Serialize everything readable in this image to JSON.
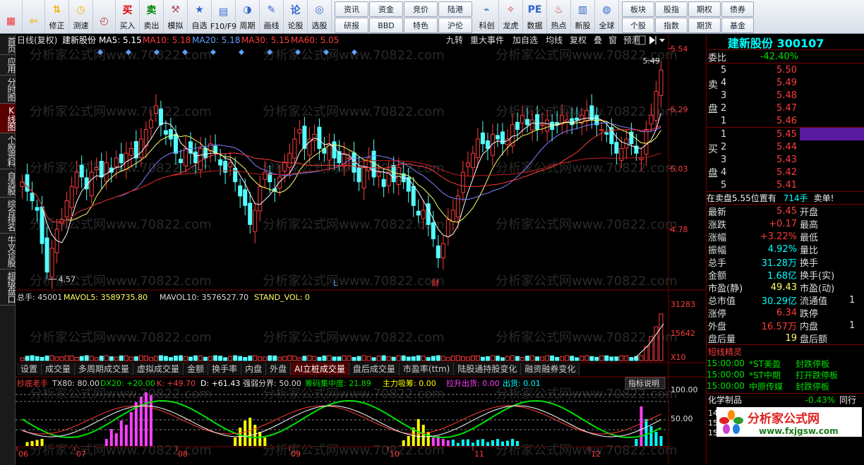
{
  "toolbar": {
    "buttons": [
      {
        "label": "",
        "icon": "windows-logo-icon"
      },
      {
        "label": "",
        "icon": "back-arrow-icon"
      },
      {
        "label": "修正",
        "icon": "updown-arrow-icon"
      },
      {
        "label": "测速",
        "icon": "speed-icon"
      },
      {
        "label": "",
        "icon": "clock-icon"
      },
      {
        "label": "买入",
        "icon": "buy-icon"
      },
      {
        "label": "卖出",
        "icon": "sell-icon"
      },
      {
        "label": "模拟",
        "icon": "hammer-icon"
      },
      {
        "label": "自选",
        "icon": "star-folder-icon"
      },
      {
        "label": "F10/F9",
        "icon": "f10-icon"
      },
      {
        "label": "周期",
        "icon": "period-icon"
      },
      {
        "label": "画线",
        "icon": "draw-icon"
      },
      {
        "label": "论股",
        "icon": "discuss-icon"
      },
      {
        "label": "选股",
        "icon": "select-icon"
      }
    ],
    "grid1": [
      "资讯",
      "资金",
      "竞价",
      "陆港",
      "研报",
      "BBD",
      "特色",
      "沪伦"
    ],
    "buttons2": [
      {
        "label": "科创",
        "icon": "kechuang-icon"
      },
      {
        "label": "龙虎",
        "icon": "dragon-icon"
      },
      {
        "label": "数据",
        "icon": "pe-icon"
      },
      {
        "label": "热点",
        "icon": "hot-icon"
      },
      {
        "label": "新股",
        "icon": "new-stock-icon"
      },
      {
        "label": "全球",
        "icon": "globe-icon"
      }
    ],
    "grid2": [
      "板块",
      "股指",
      "期权",
      "债券",
      "个股",
      "指数",
      "期货",
      "基金"
    ]
  },
  "left_tabs": [
    "首页",
    "应用",
    "分时图",
    "K线图",
    "个股资料",
    "自选股",
    "综合排名",
    "牛叉诊股",
    "超级盘口"
  ],
  "left_tab_active": "K线图",
  "chart": {
    "header": {
      "period": "日线(复权)",
      "name": "建新股份",
      "ma5": "MA5: 5.15",
      "ma10": "MA10: 5.18",
      "ma20": "MA20: 5.18",
      "ma30": "MA30: 5.15",
      "ma60": "MA60: 5.05"
    },
    "header_buttons": [
      "九转",
      "重大事件",
      "加自选",
      "均线",
      "复权",
      "叠",
      "窗",
      "预测"
    ],
    "price_axis": [
      "5.54",
      "5.29",
      "5.03",
      "4.78"
    ],
    "high_label": "5.49",
    "low_label": "4.57",
    "markers": [
      "L",
      "财"
    ],
    "vol_header": {
      "label": "总手: 45001",
      "mavol5": "MAVOL5: 3589735.80",
      "mavol10": "MAVOL10: 3576527.70",
      "stand": "STAND_VOL: 0"
    },
    "vol_axis": [
      "31283",
      "15642",
      "X10"
    ],
    "tabs": [
      "设置",
      "成交量",
      "多周期成交量",
      "虚拟成交量",
      "金额",
      "换手率",
      "内盘",
      "外盘",
      "AI立桩成交量",
      "盘后成交量",
      "市盈率(ttm)",
      "陆股通持股变化",
      "融资融券变化"
    ],
    "tab_active": "AI立桩成交量",
    "ind_header": {
      "name": "抄底老手",
      "tx80": "TX80: 80.00",
      "dx20": "DX20: +20.00",
      "k": "K: +49.70",
      "d": "D: +61.43",
      "qr": "强弱分界: 50.00",
      "cm": "筹码集中度: 21.89",
      "zl": "主力吸筹: 0.00",
      "ls": "拉升出货: 0.00",
      "ch": "出货: 0.01"
    },
    "ind_button": "指标说明",
    "ind_axis": [
      "100.00",
      "50.00"
    ],
    "months": [
      "06",
      "07",
      "08",
      "09",
      "10",
      "11",
      "12"
    ],
    "watermark": "分析家公式网www.70822.com"
  },
  "right": {
    "title": "建新股份 300107",
    "wei_bi_label": "委比",
    "wei_bi": "-42.40%",
    "sell_label": [
      "卖",
      "盘"
    ],
    "buy_label": [
      "买",
      "盘"
    ],
    "asks": [
      {
        "n": "5",
        "p": "5.50"
      },
      {
        "n": "4",
        "p": "5.49"
      },
      {
        "n": "3",
        "p": "5.48"
      },
      {
        "n": "2",
        "p": "5.47"
      },
      {
        "n": "1",
        "p": "5.46"
      }
    ],
    "bids": [
      {
        "n": "1",
        "p": "5.45"
      },
      {
        "n": "2",
        "p": "5.44"
      },
      {
        "n": "3",
        "p": "5.43"
      },
      {
        "n": "4",
        "p": "5.42"
      },
      {
        "n": "5",
        "p": "5.41"
      }
    ],
    "notice": "在卖盘5.55位置有",
    "notice_qty": "714手",
    "notice_tag": "卖单!",
    "stats": [
      [
        "最新",
        "5.45",
        "开盘",
        ""
      ],
      [
        "涨跌",
        "+0.17",
        "最高",
        ""
      ],
      [
        "涨幅",
        "+3.22%",
        "最低",
        ""
      ],
      [
        "振幅",
        "4.92%",
        "量比",
        ""
      ],
      [
        "总手",
        "31.28万",
        "换手",
        ""
      ],
      [
        "金额",
        "1.68亿",
        "换手(实)",
        ""
      ],
      [
        "市盈(静)",
        "49.43",
        "市盈(动)",
        ""
      ],
      [
        "总市值",
        "30.29亿",
        "流通值",
        "1"
      ],
      [
        "涨停",
        "6.34",
        "跌停",
        ""
      ],
      [
        "外盘",
        "16.57万",
        "内盘",
        "1"
      ],
      [
        "盘后量",
        "19",
        "盘后额",
        ""
      ]
    ],
    "sprite_title": "短线精灵",
    "sprite": [
      [
        "15:00:00",
        "*ST美盈",
        "封跌停板"
      ],
      [
        "15:00:00",
        "*ST中期",
        "打开跌停板"
      ],
      [
        "15:00:00",
        "中原传媒",
        "封跌停板"
      ]
    ],
    "sector": "化学制品",
    "sector_pct": "-0.43%",
    "sector_extra": "同行",
    "side_nums": [
      "14",
      "15",
      "15"
    ],
    "logo_text": "分析家公式网",
    "logo_url": "www.fxjgsw.com"
  }
}
